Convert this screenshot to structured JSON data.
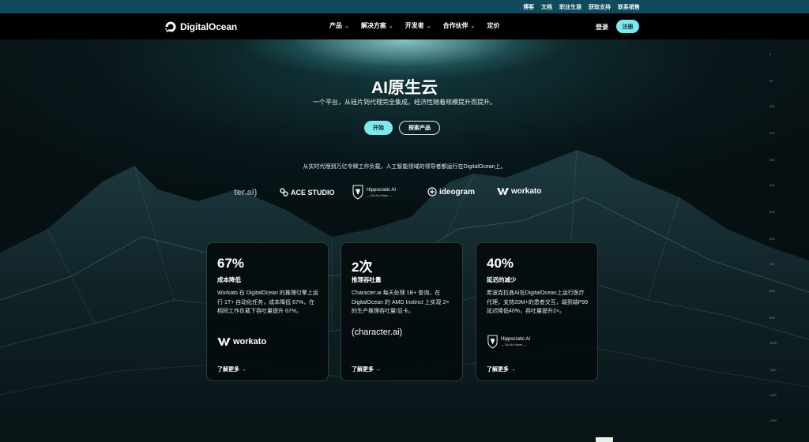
{
  "utility_links": [
    "博客",
    "文档",
    "职业生涯",
    "获取支持",
    "联系销售"
  ],
  "nav": {
    "logo_text": "DigitalOcean",
    "menu": [
      {
        "label": "产品"
      },
      {
        "label": "解决方案"
      },
      {
        "label": "开发者"
      },
      {
        "label": "合作伙伴"
      },
      {
        "label": "定价"
      }
    ],
    "login": "登录",
    "signup": "注册"
  },
  "hero": {
    "title": "AI原生云",
    "subtitle": "一个平台，从硅片到代理完全集成，经济性随着规模提升而提升。",
    "start_button": "开始",
    "explore_button": "探索产品"
  },
  "trust_line": "从实时代理到万亿令牌工作负载，人工智能领域的领导者都运行在DigitalOcean上。",
  "logos": {
    "character": "ter.ai)",
    "ace": "ACE STUDIO",
    "hippo_name": "Hippocratic AI",
    "hippo_tagline": "— Do No Harm —",
    "ideogram": "ideogram",
    "workato": "workato"
  },
  "cards": [
    {
      "stat": "67%",
      "label": "成本降低",
      "desc": "Workato 在 DigitalOcean 的推理引擎上运行 1T+ 自动化任务，成本降低 67%，在相同工作负载下吞吐量提升 67%。",
      "brand": "workato",
      "more": "了解更多 →"
    },
    {
      "stat": "2次",
      "label": "推理吞吐量",
      "desc": "Character.ai 每天处理 1B+ 查询，在 DigitalOcean 的 AMD Instinct 上实现 2× 的生产推理吞吐量/显卡。",
      "brand": "(character.ai)",
      "more": "了解更多 →"
    },
    {
      "stat": "40%",
      "label": "延迟的减少",
      "desc": "希波克拉底AI在DigitalOcean上运行医疗代理，支持20M+的患者交互，端到端P99延迟降低40%，吞吐量提升2×。",
      "brand": "Hippocratic AI",
      "brand_tagline": "— Do No Harm —",
      "more": "了解更多 →"
    }
  ],
  "ruler_ticks": [
    "0",
    "20",
    "100",
    "200",
    "300",
    "400",
    "500",
    "600",
    "700",
    "800",
    "900",
    "1000",
    "1100",
    "1200",
    "1300"
  ],
  "colors": {
    "accent": "#7fe8ee",
    "utility_bar": "#104a5c",
    "nav_bg": "#000000"
  }
}
